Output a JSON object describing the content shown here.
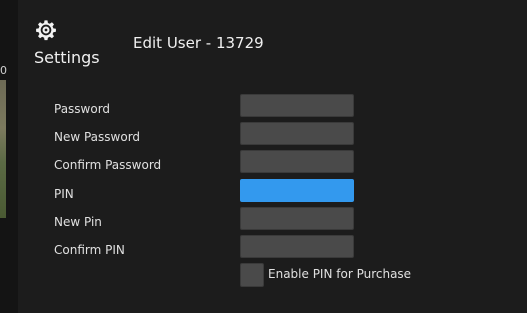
{
  "sidebar": {
    "thumb_label": "0",
    "settings_label": "Settings",
    "settings_icon": "gear-icon"
  },
  "header": {
    "title": "Edit User - 13729"
  },
  "form": {
    "password_label": "Password",
    "new_password_label": "New Password",
    "confirm_password_label": "Confirm Password",
    "pin_label": "PIN",
    "new_pin_label": "New Pin",
    "confirm_pin_label": "Confirm PIN",
    "enable_pin_purchase_label": "Enable PIN for Purchase"
  },
  "colors": {
    "accent": "#3399ee",
    "field": "#4a4a4a",
    "background": "#1c1c1c"
  }
}
